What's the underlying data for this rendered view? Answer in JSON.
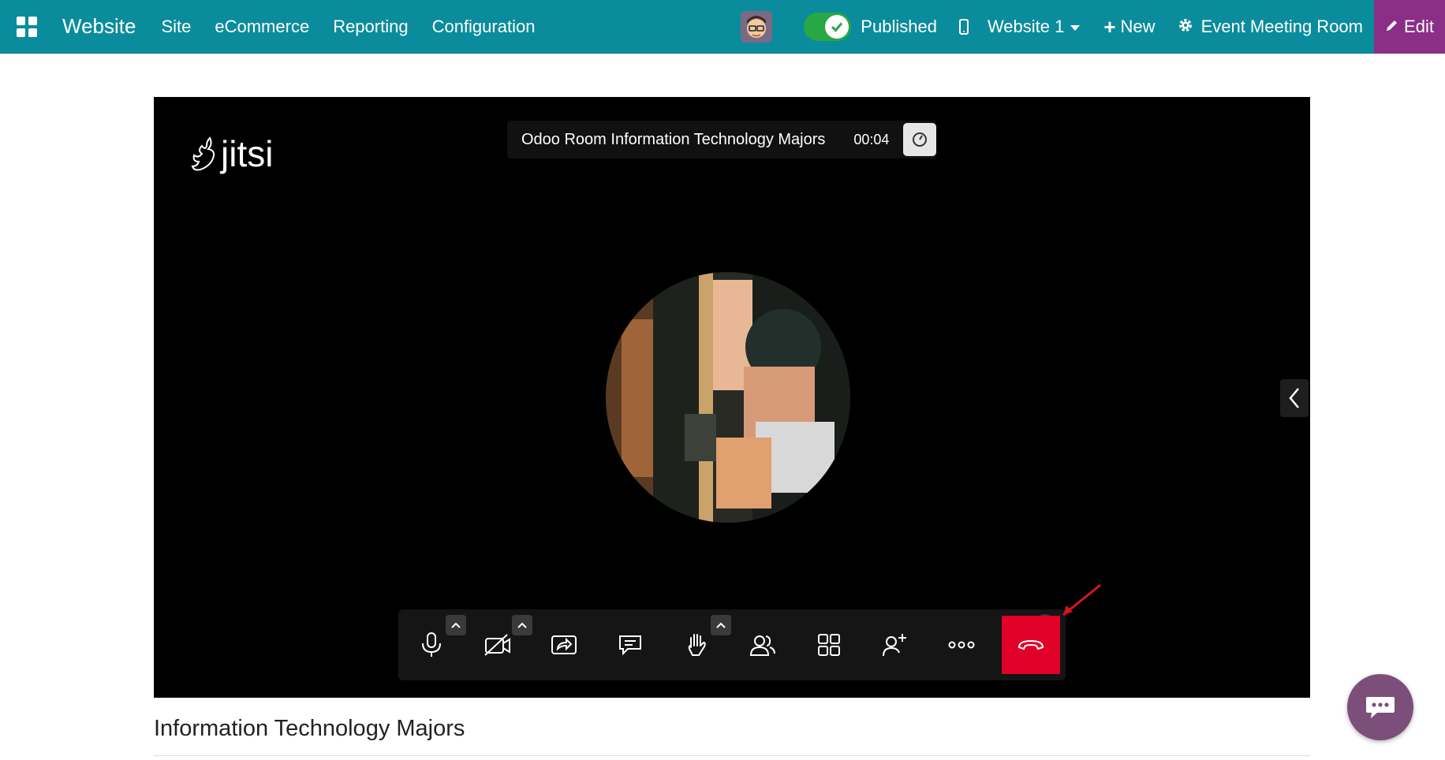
{
  "navbar": {
    "brand": "Website",
    "menu": [
      "Site",
      "eCommerce",
      "Reporting",
      "Configuration"
    ],
    "published_label": "Published",
    "website_selector": "Website 1",
    "new_label": "New",
    "record_name": "Event Meeting Room",
    "edit_label": "Edit",
    "colors": {
      "bar": "#0b8c9c",
      "edit": "#8a2e86",
      "toggle": "#28a745"
    }
  },
  "meeting": {
    "logo_text": "jitsi",
    "room_name": "Odoo Room Information Technology Majors",
    "timer": "00:04",
    "participant_count": "1",
    "toolbar_icons": [
      "microphone-icon",
      "camera-off-icon",
      "share-screen-icon",
      "chat-icon",
      "raise-hand-icon",
      "participants-icon",
      "tile-view-icon",
      "invite-icon",
      "more-icon",
      "hangup-icon"
    ],
    "hangup_color": "#e00028"
  },
  "page": {
    "title": "Information Technology Majors"
  }
}
